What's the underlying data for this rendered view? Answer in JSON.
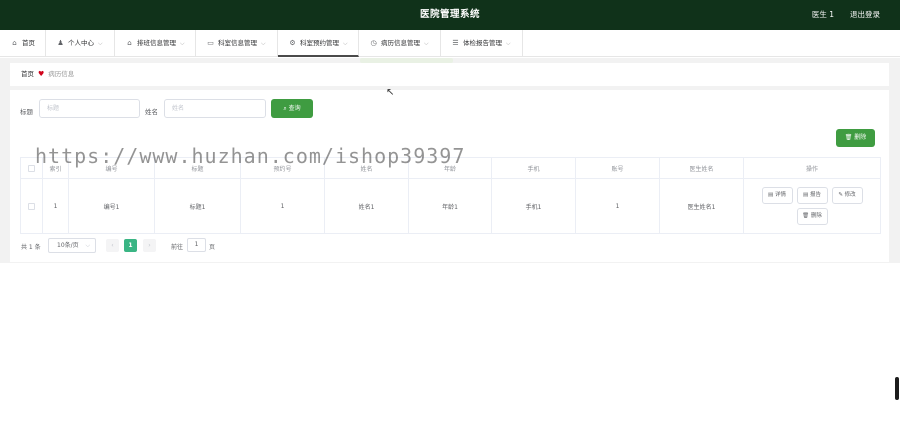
{
  "topbar": {
    "title": "医院管理系统",
    "user": "医生 1",
    "logout": "退出登录",
    "bg": "#10321a"
  },
  "nav": {
    "home": "首页",
    "items": [
      {
        "label": "个人中心",
        "icon": "person-icon"
      },
      {
        "label": "排班信息管理",
        "icon": "bank-icon"
      },
      {
        "label": "科室信息管理",
        "icon": "chat-icon"
      },
      {
        "label": "科室预约管理",
        "icon": "settings-icon"
      },
      {
        "label": "病历信息管理",
        "icon": "clock-icon"
      },
      {
        "label": "体检报告管理",
        "icon": "list-icon"
      }
    ]
  },
  "breadcrumb": {
    "home": "首页",
    "current": "病历信息"
  },
  "search": {
    "title_label": "标题",
    "title_placeholder": "标题",
    "name_label": "姓名",
    "name_placeholder": "姓名",
    "button": "查询"
  },
  "actions": {
    "delete": "删除"
  },
  "table": {
    "headers": [
      "索引",
      "编号",
      "标题",
      "预约号",
      "姓名",
      "年龄",
      "手机",
      "账号",
      "医生姓名",
      "操作"
    ],
    "rows": [
      {
        "index": "1",
        "code": "编号1",
        "title": "标题1",
        "appt": "1",
        "name": "姓名1",
        "age": "年龄1",
        "phone": "手机1",
        "account": "1",
        "doctor": "医生姓名1"
      }
    ],
    "row_actions": [
      "详情",
      "报告",
      "修改",
      "删除"
    ]
  },
  "pagination": {
    "total": "共 1 条",
    "page_size": "10条/页",
    "current": "1",
    "goto_label": "前往",
    "goto_value": "1",
    "page_label": "页"
  },
  "watermark": "https://www.huzhan.com/ishop39397",
  "colors": {
    "accent": "#3f9c41",
    "pager_active": "#3ab584"
  }
}
